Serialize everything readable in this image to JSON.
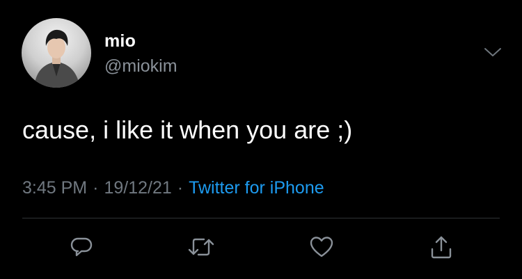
{
  "tweet": {
    "display_name": "mio",
    "handle": "@miokim",
    "text": "cause, i like it when you are ;)",
    "time": "3:45 PM",
    "date": "19/12/21",
    "separator": "·",
    "source": "Twitter for iPhone"
  },
  "icons": {
    "avatar": "profile-photo",
    "more": "chevron-down-icon",
    "reply": "reply-icon",
    "retweet": "retweet-icon",
    "like": "heart-icon",
    "share": "share-icon"
  },
  "colors": {
    "background": "#000000",
    "primary_text": "#ffffff",
    "secondary_text": "#8a9199",
    "meta_text": "#707880",
    "link": "#1d9bf0",
    "icon": "#8a9199",
    "divider": "#2f3336"
  }
}
